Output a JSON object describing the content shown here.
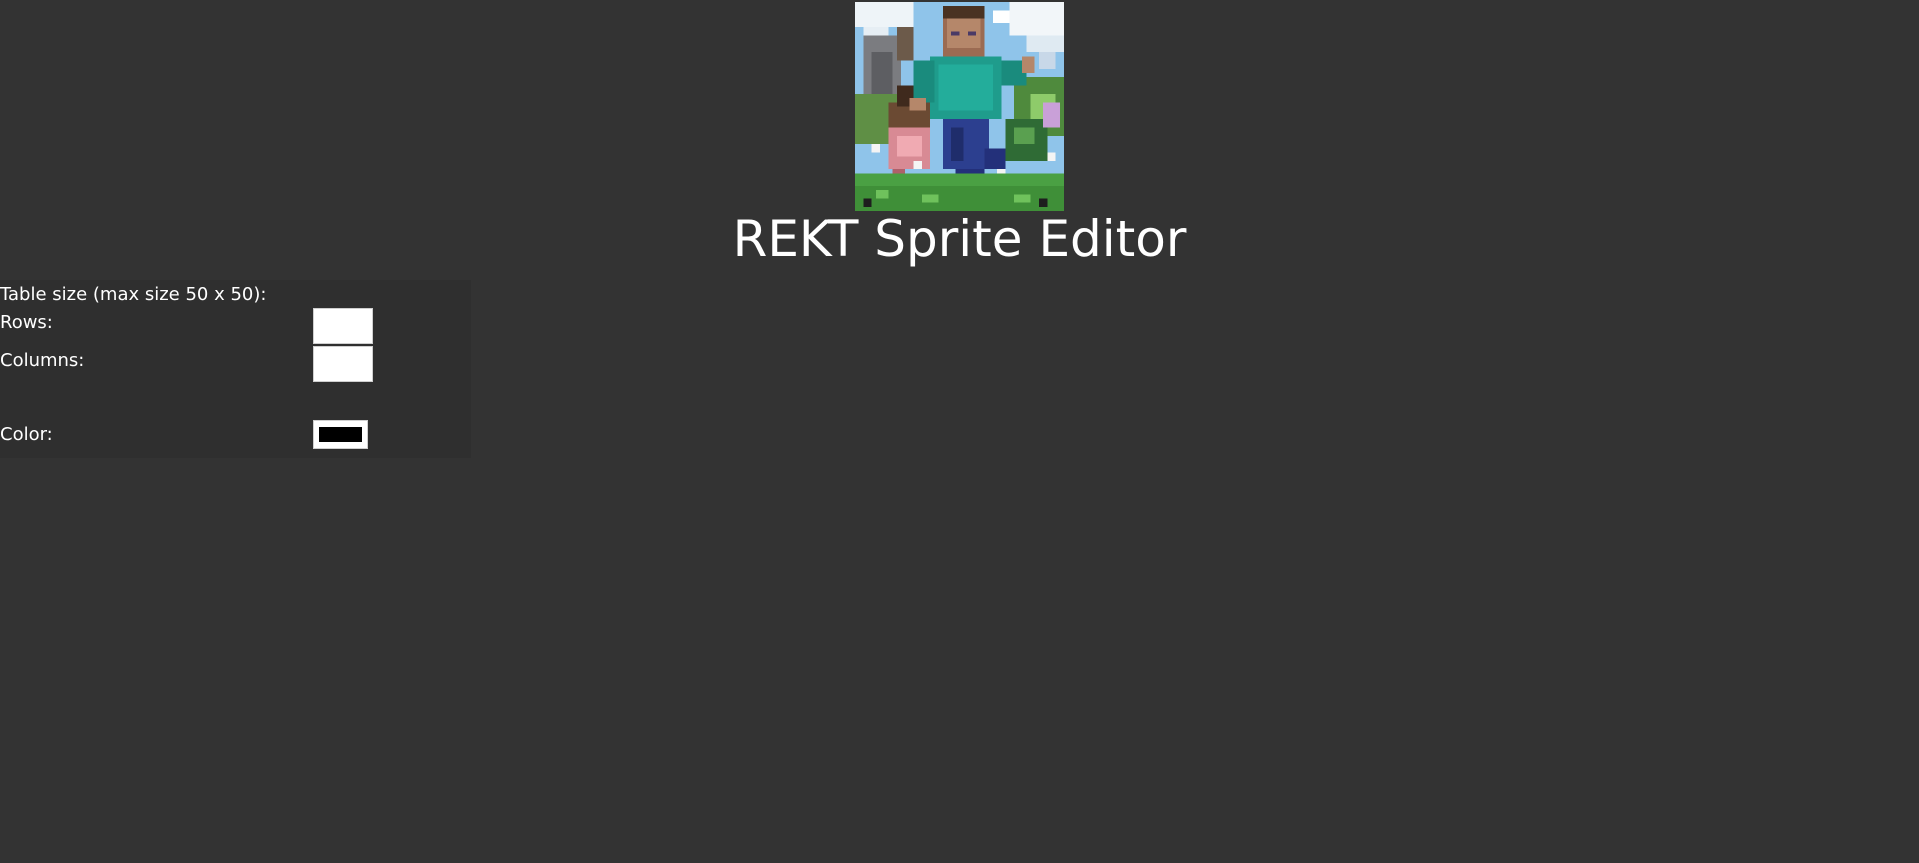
{
  "page": {
    "title": "REKT Sprite Editor",
    "background_color": "#333333"
  },
  "logo": {
    "name": "pixelated-runner-logo"
  },
  "settings": {
    "table_size_label": "Table size (max size 50 x 50):",
    "rows_label": "Rows:",
    "rows_value": "",
    "columns_label": "Columns:",
    "columns_value": "",
    "color_label": "Color:",
    "color_value": "#000000"
  }
}
